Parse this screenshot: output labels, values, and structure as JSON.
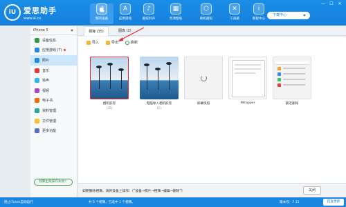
{
  "app": {
    "logo_mark": "iU",
    "name": "爱思助手",
    "url": "www.i4.cn",
    "window_buttons": [
      "—",
      "☐",
      "✕"
    ],
    "download_label": "下载中心"
  },
  "nav": [
    {
      "label": "我的设备",
      "icon": "apple-icon",
      "glyph": ""
    },
    {
      "label": "应用游戏",
      "icon": "app-store-icon",
      "glyph": "A"
    },
    {
      "label": "酷炫铃声",
      "icon": "bell-icon",
      "glyph": "♪"
    },
    {
      "label": "高清壁纸",
      "icon": "image-icon",
      "glyph": "▦"
    },
    {
      "label": "刷机越狱",
      "icon": "box-icon",
      "glyph": "⬡"
    },
    {
      "label": "工具箱",
      "icon": "tools-icon",
      "glyph": "✕"
    },
    {
      "label": "教程中心",
      "icon": "info-icon",
      "glyph": "i"
    }
  ],
  "device": {
    "name": "iPhone 5"
  },
  "sidebar": {
    "items": [
      {
        "label": "设备信息",
        "color": "#2e9b4a"
      },
      {
        "label": "应用游戏 (7)",
        "color": "#1e88e5",
        "badge": true
      },
      {
        "label": "照片",
        "color": "#1e88e5",
        "active": true
      },
      {
        "label": "音乐",
        "color": "#e53935"
      },
      {
        "label": "铃声",
        "color": "#29b6f6"
      },
      {
        "label": "视频",
        "color": "#ab47bc"
      },
      {
        "label": "电子书",
        "color": "#ef6c00"
      },
      {
        "label": "资料管理",
        "color": "#26a69a"
      },
      {
        "label": "文件管理",
        "color": "#fbc02d"
      },
      {
        "label": "更多功能",
        "color": "#5c6bc0"
      }
    ],
    "help_label": "频繁出现操作失败？"
  },
  "tabs": [
    {
      "label": "相簿 (35)",
      "active": true
    },
    {
      "label": "图库 (2)",
      "active": false
    }
  ],
  "toolbar": {
    "import_label": "导入",
    "export_label": "导出",
    "refresh_label": "刷新"
  },
  "albums": [
    {
      "name": "相机胶卷",
      "count": "(35)",
      "thumb": "beach",
      "selected": true
    },
    {
      "name": "电脑导入相机胶卷",
      "count": "(2)",
      "thumb": "beach",
      "selected": false
    },
    {
      "name": "屏幕快照",
      "count": "",
      "thumb": "loading",
      "selected": false
    },
    {
      "name": "IWrapper",
      "count": "",
      "thumb": "phone",
      "selected": false
    },
    {
      "name": "最近删除",
      "count": "",
      "thumb": "settings",
      "selected": false
    }
  ],
  "footer": {
    "tip": "如要删除相簿，请到设备上操作：(“设备→照片→相簿→编辑→删除”)",
    "close_label": "关闭"
  },
  "status": {
    "itunes": "阻止iTunes自动运行",
    "selection": "共 5 个相簿，已选中 1 个相簿。",
    "version": "版本号：7.11",
    "update_label": "检查更新"
  }
}
